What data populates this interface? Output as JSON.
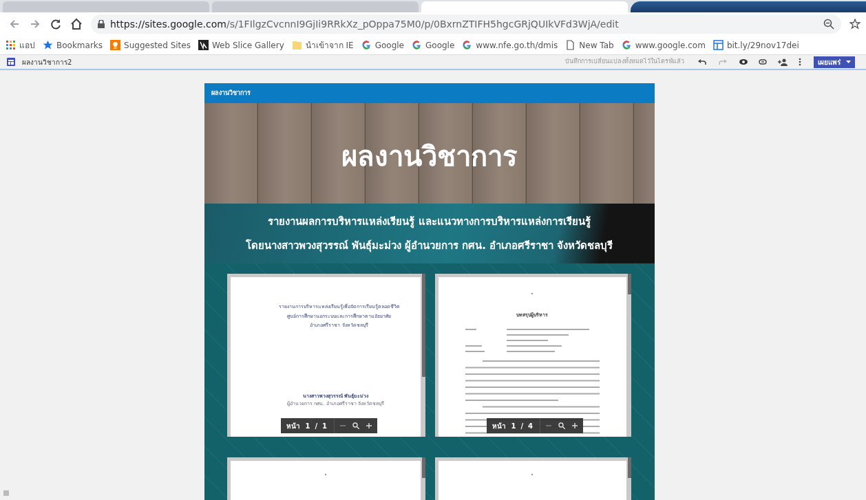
{
  "browser": {
    "tabs": [
      {
        "selected": false
      },
      {
        "selected": false
      },
      {
        "selected": true
      }
    ],
    "address": {
      "host": "https://sites.google.com",
      "path": "/s/1FIlgzCvcnnI9GjIi9RRkXz_pOppa75M0/p/0BxrnZTIFH5hgcGRjQUIkVFd3WjA/edit"
    },
    "bookmarks": [
      {
        "kind": "apps",
        "label": "แอป"
      },
      {
        "kind": "star",
        "label": "Bookmarks"
      },
      {
        "kind": "bulb",
        "label": "Suggested Sites"
      },
      {
        "kind": "slice",
        "label": "Web Slice Gallery"
      },
      {
        "kind": "folder",
        "label": "นำเข้าจาก IE"
      },
      {
        "kind": "google",
        "label": "Google"
      },
      {
        "kind": "google",
        "label": "Google"
      },
      {
        "kind": "google",
        "label": "www.nfe.go.th/dmis"
      },
      {
        "kind": "page",
        "label": "New Tab"
      },
      {
        "kind": "google",
        "label": "www.google.com"
      },
      {
        "kind": "sheet",
        "label": "bit.ly/29nov17dei"
      }
    ]
  },
  "editor": {
    "site_name": "ผลงานวิชาการ2",
    "save_status": "บันทึกการเปลี่ยนแปลงทั้งหมดไว้ในไดรฟ์แล้ว",
    "publish_button": "เผยแพร่"
  },
  "site": {
    "nav_title": "ผลงานวิชาการ",
    "hero_title": "ผลงานวิชาการ",
    "subtitle_lines": [
      "รายงานผลการบริหารแหล่งเรียนรู้ และแนวทางการบริหารแหล่งการเรียนรู้",
      "โดยนางสาวพวงสุวรรณ์  พันธุ์มะม่วง ผู้อำนวยการ กศน. อำเภอศรีราชา จังหวัดชลบุรี"
    ],
    "documents": [
      {
        "kind": "cover",
        "title_lines": [
          "รายงานการบริหารแหล่งเรียนรู้เพื่อจัดการเรียนรู้ตลอดชีวิต",
          "ศูนย์การศึกษานอกระบบและการศึกษาตามอัธยาศัย",
          "อำเภอศรีราชา จังหวัดชลบุรี"
        ],
        "author": "นางสาวพวงสุวรรณ์  พันธุ์มะม่วง",
        "author_role": "ผู้อำนวยการ กศน. อำเภอศรีราชา จังหวัดชลบุรี",
        "page_label": "หน้า",
        "page_count": "1  /  1"
      },
      {
        "kind": "summary",
        "heading": "บทสรุปผู้บริหาร",
        "page_label": "หน้า",
        "page_count": "1  /  4"
      },
      {
        "kind": "blank"
      },
      {
        "kind": "blank"
      }
    ]
  }
}
